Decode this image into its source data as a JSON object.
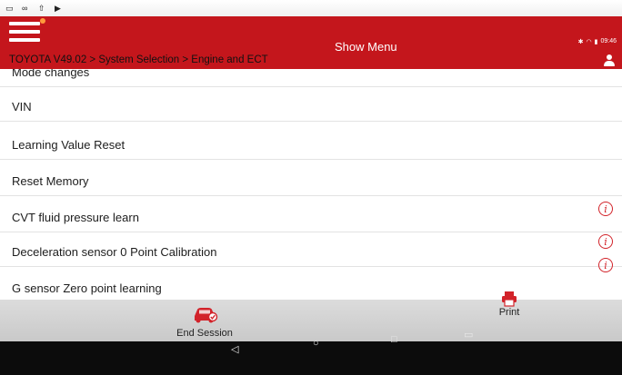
{
  "header": {
    "title": "Show Menu",
    "breadcrumb": "TOYOTA V49.02 > System Selection > Engine and ECT",
    "status_right": "09:46"
  },
  "menu_items": [
    {
      "label": "Mode changes",
      "info": false
    },
    {
      "label": "VIN",
      "info": false
    },
    {
      "label": "Learning Value Reset",
      "info": false
    },
    {
      "label": "Reset Memory",
      "info": false
    },
    {
      "label": "CVT fluid pressure learn",
      "info": true
    },
    {
      "label": "Deceleration sensor 0 Point Calibration",
      "info": true
    },
    {
      "label": "G sensor Zero point learning",
      "info": true
    }
  ],
  "info_glyph": "i",
  "bottom": {
    "end_session_label": "End Session",
    "print_label": "Print"
  },
  "nav": {
    "back": "◁",
    "home": "○",
    "recents": "□",
    "extra": "▭"
  },
  "colors": {
    "accent": "#c4161c",
    "info": "#d2232a",
    "notification_dot": "#ff9a3c"
  }
}
